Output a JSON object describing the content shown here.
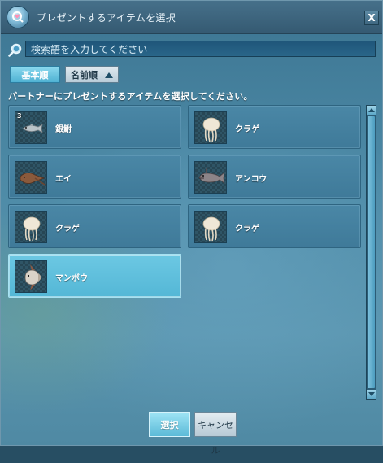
{
  "window": {
    "title": "プレゼントするアイテムを選択",
    "close_label": "X",
    "title_icon": "heart-search-icon"
  },
  "search": {
    "placeholder": "検索語を入力してください",
    "icon": "search-icon"
  },
  "sort": {
    "basic_label": "基本順",
    "name_label": "名前順",
    "active": "basic"
  },
  "instruction": "パートナーにプレゼントするアイテムを選択してください。",
  "items": [
    {
      "name": "銀鮒",
      "icon": "silver-carp-icon",
      "quantity": "3",
      "selected": false
    },
    {
      "name": "クラゲ",
      "icon": "jellyfish-icon",
      "quantity": "",
      "selected": false
    },
    {
      "name": "エイ",
      "icon": "ray-fish-icon",
      "quantity": "",
      "selected": false
    },
    {
      "name": "アンコウ",
      "icon": "anglerfish-icon",
      "quantity": "",
      "selected": false
    },
    {
      "name": "クラゲ",
      "icon": "jellyfish-icon",
      "quantity": "",
      "selected": false
    },
    {
      "name": "クラゲ",
      "icon": "jellyfish-icon",
      "quantity": "",
      "selected": false
    },
    {
      "name": "マンボウ",
      "icon": "sunfish-icon",
      "quantity": "",
      "selected": true
    }
  ],
  "buttons": {
    "select_label": "選択",
    "cancel_label": "キャンセル"
  },
  "colors": {
    "accent": "#5bbad8",
    "selected_card": "#6cc8e3",
    "card": "#4a87a6"
  }
}
